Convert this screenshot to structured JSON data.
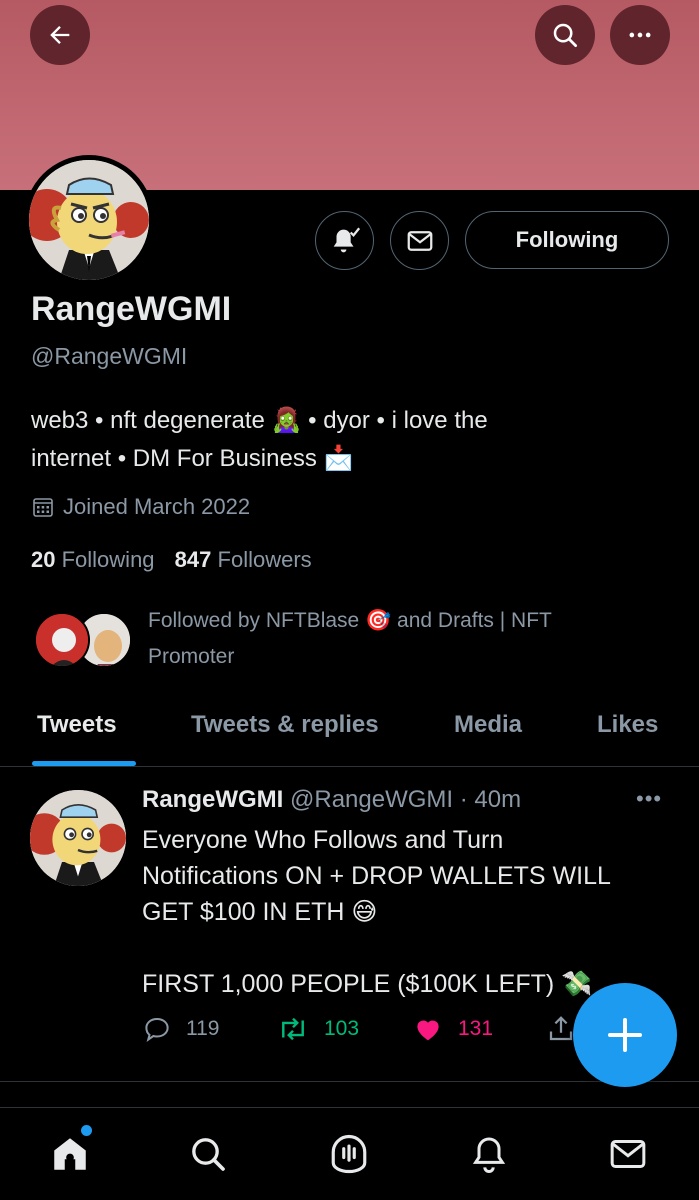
{
  "header": {
    "back_icon": "arrow-left-icon",
    "search_icon": "search-icon",
    "more_icon": "more-horizontal-icon",
    "banner_color": "#c2656f"
  },
  "profile": {
    "name": "RangeWGMI",
    "handle": "@RangeWGMI",
    "bio_line1": "web3 • nft degenerate 🧟‍♀️ • dyor • i love the",
    "bio_line2": "internet • DM For Business 📩",
    "joined": "Joined March 2022",
    "following_count": "20",
    "following_label": "Following",
    "followers_count": "847",
    "followers_label": "Followers",
    "followed_by_line1": "Followed by NFTBlase 🎯 and Drafts | NFT",
    "followed_by_line2": "Promoter"
  },
  "actions": {
    "notify_icon": "bell-check-icon",
    "message_icon": "mail-icon",
    "following_button": "Following"
  },
  "tabs": [
    "Tweets",
    "Tweets & replies",
    "Media",
    "Likes"
  ],
  "tweet": {
    "name": "RangeWGMI",
    "handle_time": "@RangeWGMI · 40m",
    "more": "•••",
    "line1": "Everyone Who Follows and Turn",
    "line2": "Notifications ON + DROP WALLETS WILL",
    "line3": "GET $100 IN ETH 😅",
    "line4": "FIRST 1,000 PEOPLE ($100K LEFT) 💸",
    "replies": "119",
    "retweets": "103",
    "likes": "131"
  },
  "colors": {
    "accent": "#1d9bf0",
    "retweet": "#00ba7c",
    "like": "#f91880",
    "muted": "#8b98a5"
  },
  "bottom_nav": [
    "home-icon",
    "search-icon",
    "spaces-icon",
    "notifications-icon",
    "messages-icon"
  ]
}
